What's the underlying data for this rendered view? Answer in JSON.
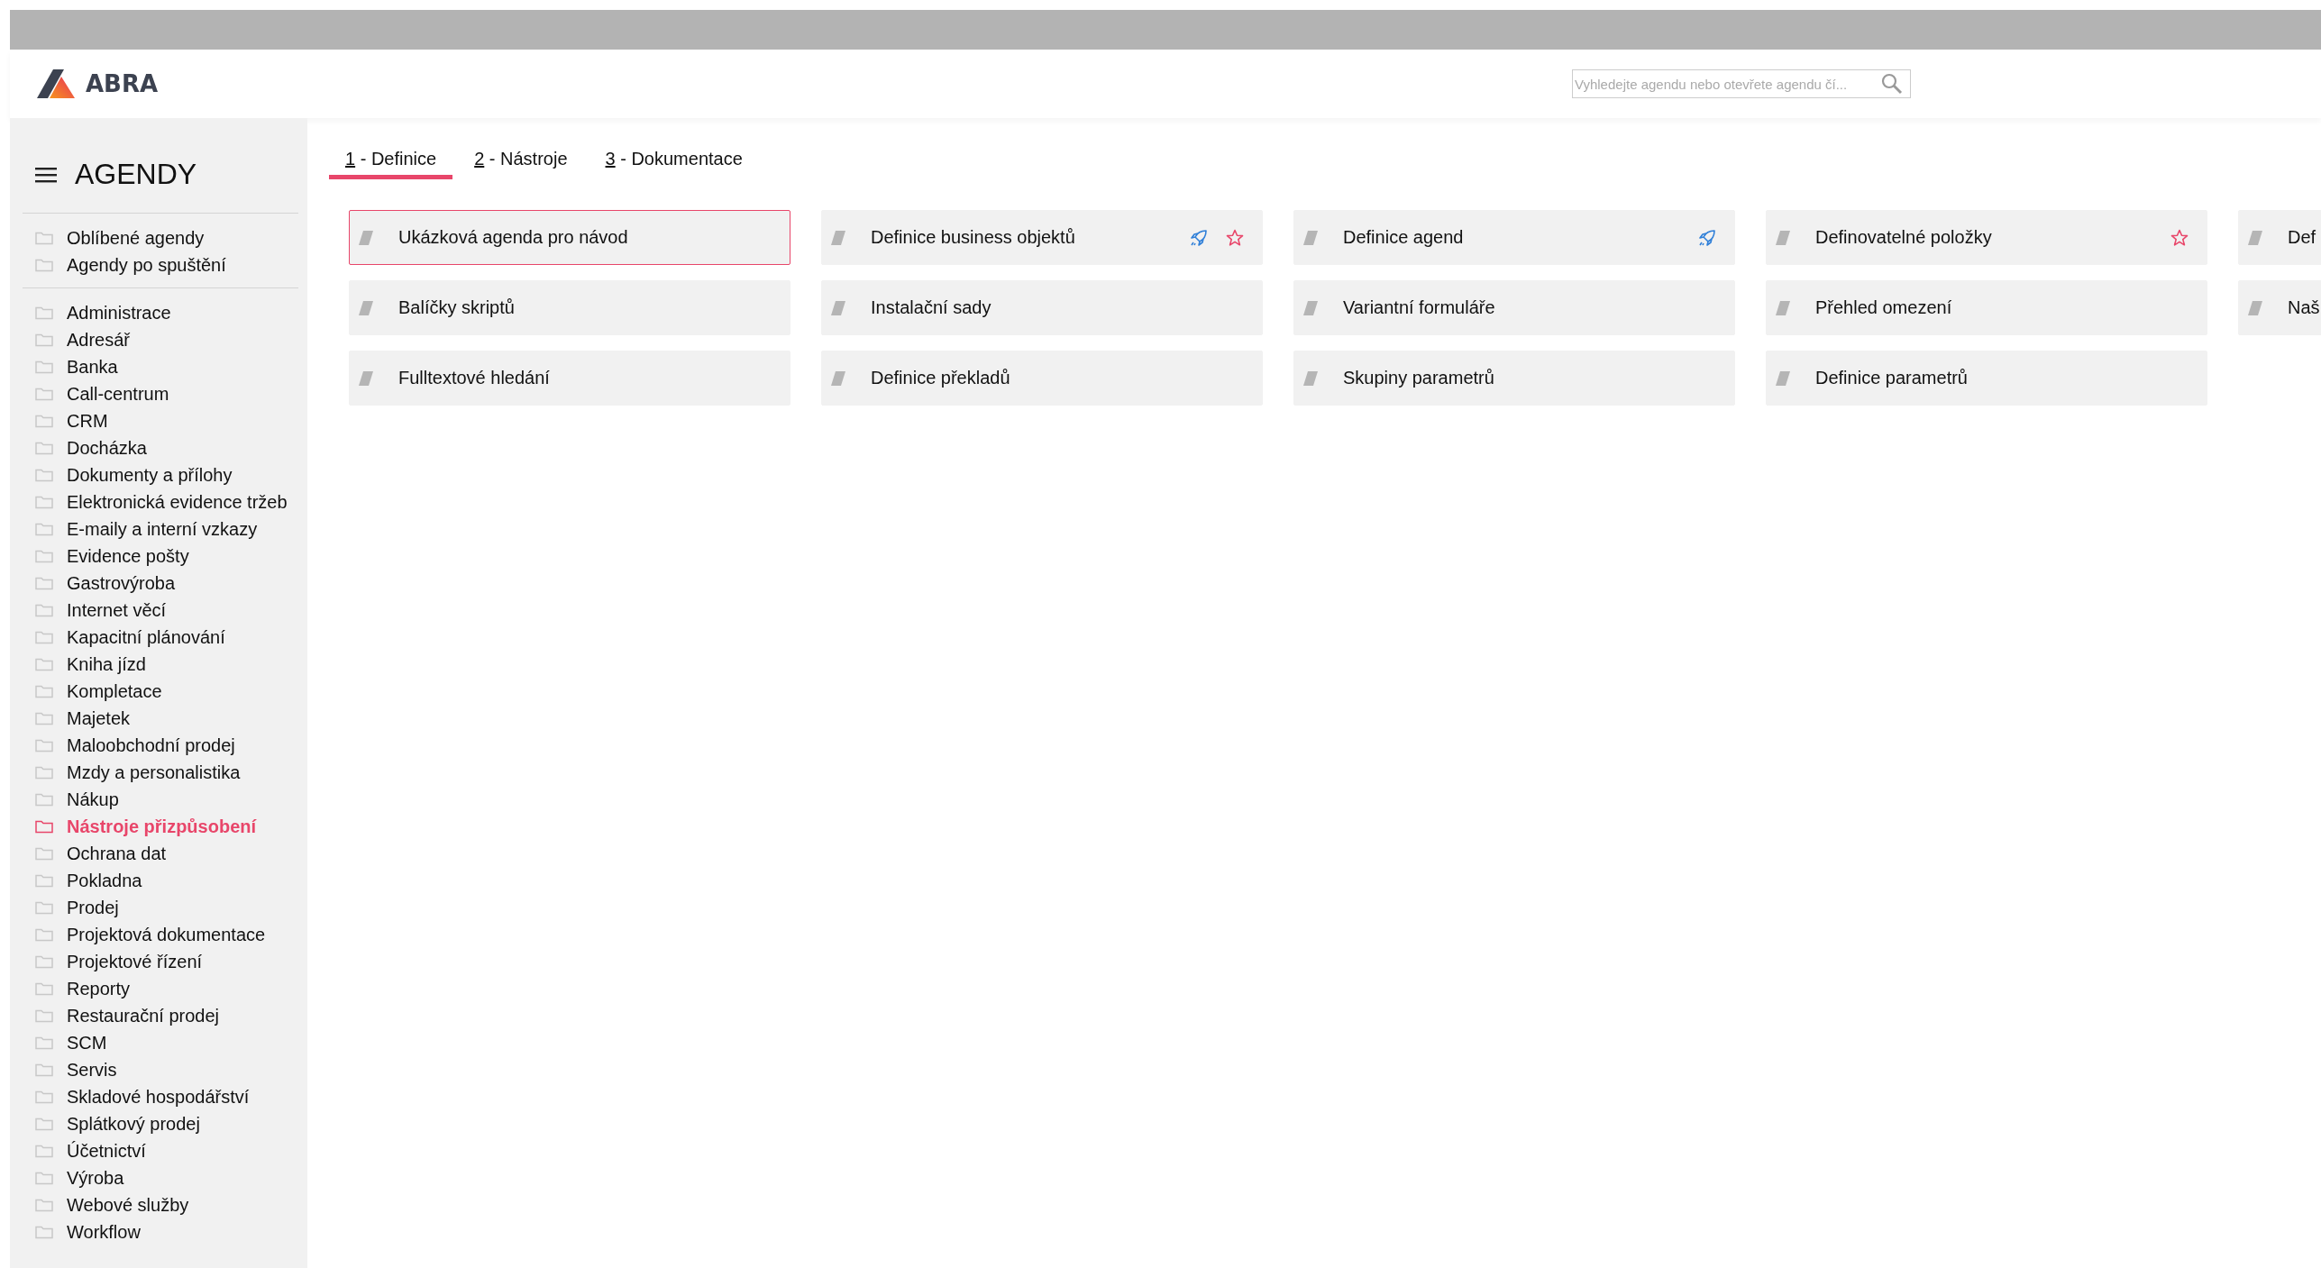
{
  "header": {
    "logo": "ABRA",
    "search": {
      "placeholder": "Vyhledejte agendu nebo otevřete agendu čí..."
    }
  },
  "sidebar": {
    "title": "AGENDY",
    "groups": [
      [
        {
          "label": "Oblíbené agendy",
          "selected": false
        },
        {
          "label": "Agendy po spuštění",
          "selected": false
        }
      ],
      [
        {
          "label": "Administrace",
          "selected": false
        },
        {
          "label": "Adresář",
          "selected": false
        },
        {
          "label": "Banka",
          "selected": false
        },
        {
          "label": "Call-centrum",
          "selected": false
        },
        {
          "label": "CRM",
          "selected": false
        },
        {
          "label": "Docházka",
          "selected": false
        },
        {
          "label": "Dokumenty a přílohy",
          "selected": false
        },
        {
          "label": "Elektronická evidence tržeb",
          "selected": false
        },
        {
          "label": "E-maily a interní vzkazy",
          "selected": false
        },
        {
          "label": "Evidence pošty",
          "selected": false
        },
        {
          "label": "Gastrovýroba",
          "selected": false
        },
        {
          "label": "Internet věcí",
          "selected": false
        },
        {
          "label": "Kapacitní plánování",
          "selected": false
        },
        {
          "label": "Kniha jízd",
          "selected": false
        },
        {
          "label": "Kompletace",
          "selected": false
        },
        {
          "label": "Majetek",
          "selected": false
        },
        {
          "label": "Maloobchodní prodej",
          "selected": false
        },
        {
          "label": "Mzdy a personalistika",
          "selected": false
        },
        {
          "label": "Nákup",
          "selected": false
        },
        {
          "label": "Nástroje přizpůsobení",
          "selected": true
        },
        {
          "label": "Ochrana dat",
          "selected": false
        },
        {
          "label": "Pokladna",
          "selected": false
        },
        {
          "label": "Prodej",
          "selected": false
        },
        {
          "label": "Projektová dokumentace",
          "selected": false
        },
        {
          "label": "Projektové řízení",
          "selected": false
        },
        {
          "label": "Reporty",
          "selected": false
        },
        {
          "label": "Restaurační prodej",
          "selected": false
        },
        {
          "label": "SCM",
          "selected": false
        },
        {
          "label": "Servis",
          "selected": false
        },
        {
          "label": "Skladové hospodářství",
          "selected": false
        },
        {
          "label": "Splátkový prodej",
          "selected": false
        },
        {
          "label": "Účetnictví",
          "selected": false
        },
        {
          "label": "Výroba",
          "selected": false
        },
        {
          "label": "Webové služby",
          "selected": false
        },
        {
          "label": "Workflow",
          "selected": false
        }
      ]
    ]
  },
  "tabs": [
    {
      "label": "1 - Definice",
      "selected": true
    },
    {
      "label": "2 - Nástroje",
      "selected": false
    },
    {
      "label": "3 - Dokumentace",
      "selected": false
    }
  ],
  "tiles": [
    {
      "label": "Ukázková agenda pro návod",
      "selected": true,
      "pinned": false,
      "favorite": false
    },
    {
      "label": "Balíčky skriptů",
      "selected": false,
      "pinned": false,
      "favorite": false
    },
    {
      "label": "Fulltextové hledání",
      "selected": false,
      "pinned": false,
      "favorite": false
    },
    {
      "label": "Definice business objektů",
      "selected": false,
      "pinned": true,
      "favorite": true
    },
    {
      "label": "Instalační sady",
      "selected": false,
      "pinned": false,
      "favorite": false
    },
    {
      "label": "Definice překladů",
      "selected": false,
      "pinned": false,
      "favorite": false
    },
    {
      "label": "Definice agend",
      "selected": false,
      "pinned": true,
      "favorite": false
    },
    {
      "label": "Variantní formuláře",
      "selected": false,
      "pinned": false,
      "favorite": false
    },
    {
      "label": "Skupiny parametrů",
      "selected": false,
      "pinned": false,
      "favorite": false
    },
    {
      "label": "Definovatelné položky",
      "selected": false,
      "pinned": false,
      "favorite": true
    },
    {
      "label": "Přehled omezení",
      "selected": false,
      "pinned": false,
      "favorite": false
    },
    {
      "label": "Definice parametrů",
      "selected": false,
      "pinned": false,
      "favorite": false
    },
    {
      "label": "Def",
      "selected": false,
      "pinned": false,
      "favorite": false
    },
    {
      "label": "Naš",
      "selected": false,
      "pinned": false,
      "favorite": false
    }
  ]
}
